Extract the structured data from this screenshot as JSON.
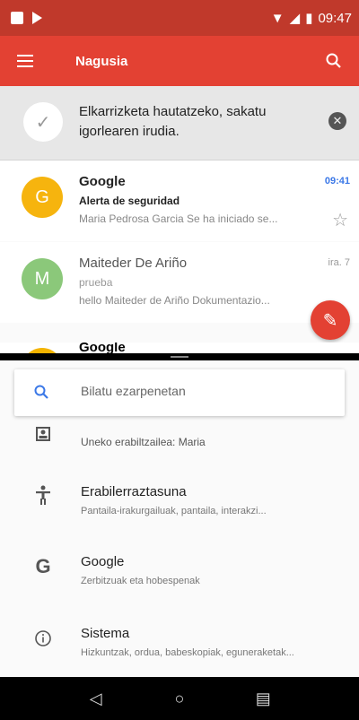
{
  "status_bar": {
    "time": "09:47"
  },
  "app_bar": {
    "title": "Nagusia"
  },
  "hint": {
    "text": "Elkarrizketa hautatzeko, sakatu igorlearen irudia."
  },
  "mails": [
    {
      "initial": "G",
      "from": "Google",
      "time": "09:41",
      "subject": "Alerta de seguridad",
      "snippet": "Maria Pedrosa Garcia Se ha iniciado se...",
      "avatar_color": "#f6b40e",
      "unread": true
    },
    {
      "initial": "M",
      "from": "Maiteder De Ariño",
      "time": "ira. 7",
      "subject": "prueba",
      "snippet": "hello Maiteder de Ariño Dokumentazio...",
      "avatar_color": "#8bc87a",
      "unread": false
    }
  ],
  "peek_mail": {
    "from": "Google"
  },
  "settings": {
    "search_placeholder": "Bilatu ezarpenetan",
    "items": [
      {
        "icon": "user-icon",
        "title": "",
        "subtitle": "Uneko erabiltzailea: Maria"
      },
      {
        "icon": "accessibility-icon",
        "title": "Erabilerraztasuna",
        "subtitle": "Pantaila-irakurgailuak, pantaila, interakzi..."
      },
      {
        "icon": "google-icon",
        "title": "Google",
        "subtitle": "Zerbitzuak eta hobespenak"
      },
      {
        "icon": "info-icon",
        "title": "Sistema",
        "subtitle": "Hizkuntzak, ordua, babeskopiak, eguneraketak..."
      }
    ]
  },
  "colors": {
    "status_bar": "#c0392b",
    "app_bar": "#e34133",
    "accent_blue": "#3b78e7"
  }
}
